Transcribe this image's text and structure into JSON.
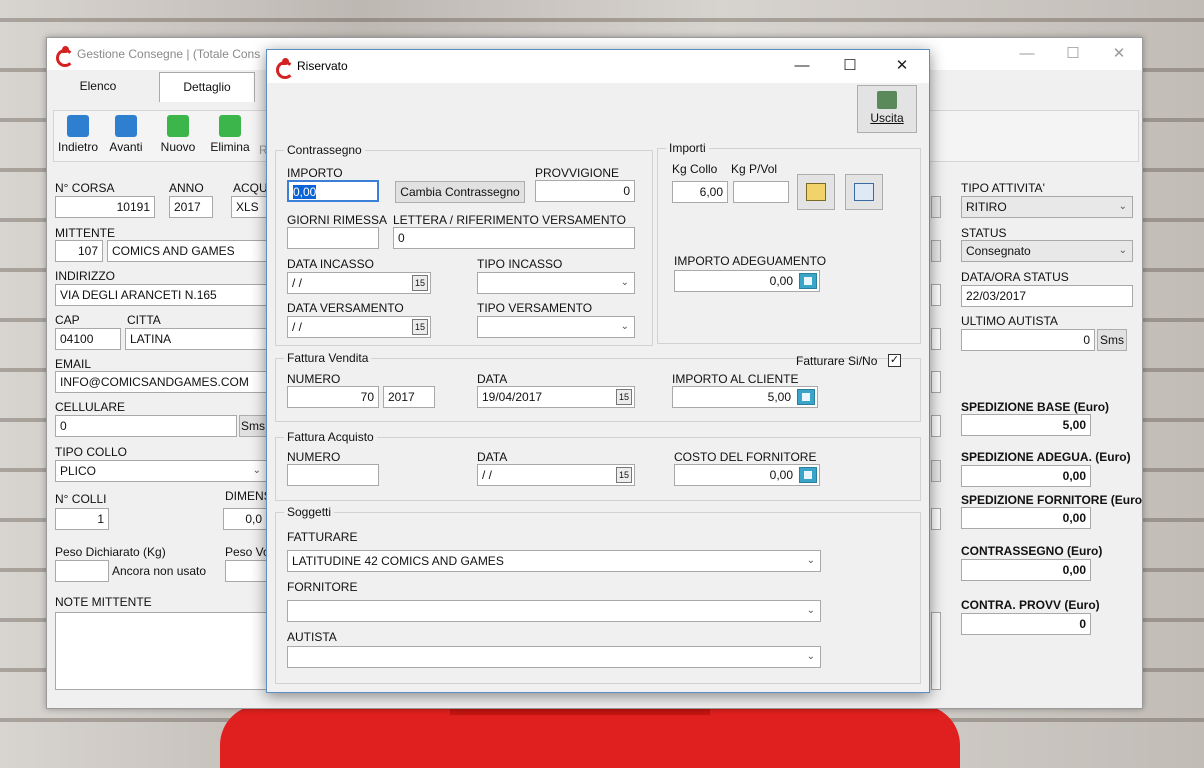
{
  "main_window": {
    "title": "Gestione Consegne | (Totale Cons",
    "tabs": [
      "Elenco",
      "Dettaglio"
    ],
    "toolbar": [
      "Indietro",
      "Avanti",
      "Nuovo",
      "Elimina"
    ],
    "toolbar_extra": "R",
    "left": {
      "n_corsa_label": "N° CORSA",
      "n_corsa": "10191",
      "anno_label": "ANNO",
      "anno": "2017",
      "acqu_label": "ACQU",
      "acqu": "XLS",
      "mittente_label": "MITTENTE",
      "mittente_code": "107",
      "mittente_name": "COMICS AND GAMES",
      "indirizzo_label": "INDIRIZZO",
      "indirizzo": "VIA DEGLI ARANCETI N.165",
      "cap_label": "CAP",
      "cap": "04100",
      "citta_label": "CITTA",
      "citta": "LATINA",
      "email_label": "EMAIL",
      "email": "INFO@COMICSANDGAMES.COM",
      "cellulare_label": "CELLULARE",
      "cellulare": "0",
      "sms": "Sms",
      "tipo_collo_label": "TIPO COLLO",
      "tipo_collo": "PLICO",
      "n_colli_label": "N° COLLI",
      "n_colli": "1",
      "dimens_label": "DIMENS",
      "dimens": "0,0",
      "peso_dich_label": "Peso Dichiarato (Kg)",
      "peso_vol_label": "Peso Vo",
      "ancora": "Ancora non usato",
      "note_label": "NOTE MITTENTE"
    },
    "right": {
      "tipo_attivita_label": "TIPO ATTIVITA'",
      "tipo_attivita": "RITIRO",
      "status_label": "STATUS",
      "status": "Consegnato",
      "data_status_label": "DATA/ORA STATUS",
      "data_status": "22/03/2017",
      "ultimo_autista_label": "ULTIMO AUTISTA",
      "ultimo_autista": "0",
      "sms": "Sms",
      "sped_base_label": "SPEDIZIONE BASE (Euro)",
      "sped_base": "5,00",
      "sped_adeg_label": "SPEDIZIONE ADEGUA. (Euro)",
      "sped_adeg": "0,00",
      "sped_forn_label": "SPEDIZIONE FORNITORE (Euro",
      "sped_forn": "0,00",
      "contrassegno_label": "CONTRASSEGNO (Euro)",
      "contrassegno": "0,00",
      "contra_provv_label": "CONTRA.  PROVV (Euro)",
      "contra_provv": "0"
    }
  },
  "dialog": {
    "title": "Riservato",
    "uscita": "Uscita",
    "contrassegno": {
      "title": "Contrassegno",
      "importo_label": "IMPORTO",
      "importo": "0,00",
      "cambia_btn": "Cambia Contrassegno",
      "provvigione_label": "PROVVIGIONE",
      "provvigione": "0",
      "giorni_label": "GIORNI RIMESSA",
      "giorni": "",
      "lettera_label": "LETTERA / RIFERIMENTO VERSAMENTO",
      "lettera": "0",
      "data_incasso_label": "DATA INCASSO",
      "data_incasso": " / /",
      "tipo_incasso_label": "TIPO INCASSO",
      "data_versamento_label": "DATA VERSAMENTO",
      "data_versamento": " / /",
      "tipo_versamento_label": "TIPO VERSAMENTO"
    },
    "importi": {
      "title": "Importi",
      "kg_collo_label": "Kg Collo",
      "kg_collo": "6,00",
      "kg_pvol_label": "Kg P/Vol",
      "kg_pvol": "",
      "importo_adeg_label": "IMPORTO ADEGUAMENTO",
      "importo_adeg": "0,00"
    },
    "fattura_vendita": {
      "title": "Fattura Vendita",
      "fatturare_label": "Fatturare Si/No",
      "fatturare_checked": true,
      "numero_label": "NUMERO",
      "numero": "70",
      "anno": "2017",
      "data_label": "DATA",
      "data": "19/04/2017",
      "importo_cliente_label": "IMPORTO AL CLIENTE",
      "importo_cliente": "5,00"
    },
    "fattura_acquisto": {
      "title": "Fattura Acquisto",
      "numero_label": "NUMERO",
      "numero": "",
      "data_label": "DATA",
      "data": " / /",
      "costo_label": "COSTO DEL FORNITORE",
      "costo": "0,00"
    },
    "soggetti": {
      "title": "Soggetti",
      "fatturare_label": "FATTURARE",
      "fatturare": "LATITUDINE 42 COMICS AND GAMES",
      "fornitore_label": "FORNITORE",
      "fornitore": "",
      "autista_label": "AUTISTA",
      "autista": ""
    }
  }
}
